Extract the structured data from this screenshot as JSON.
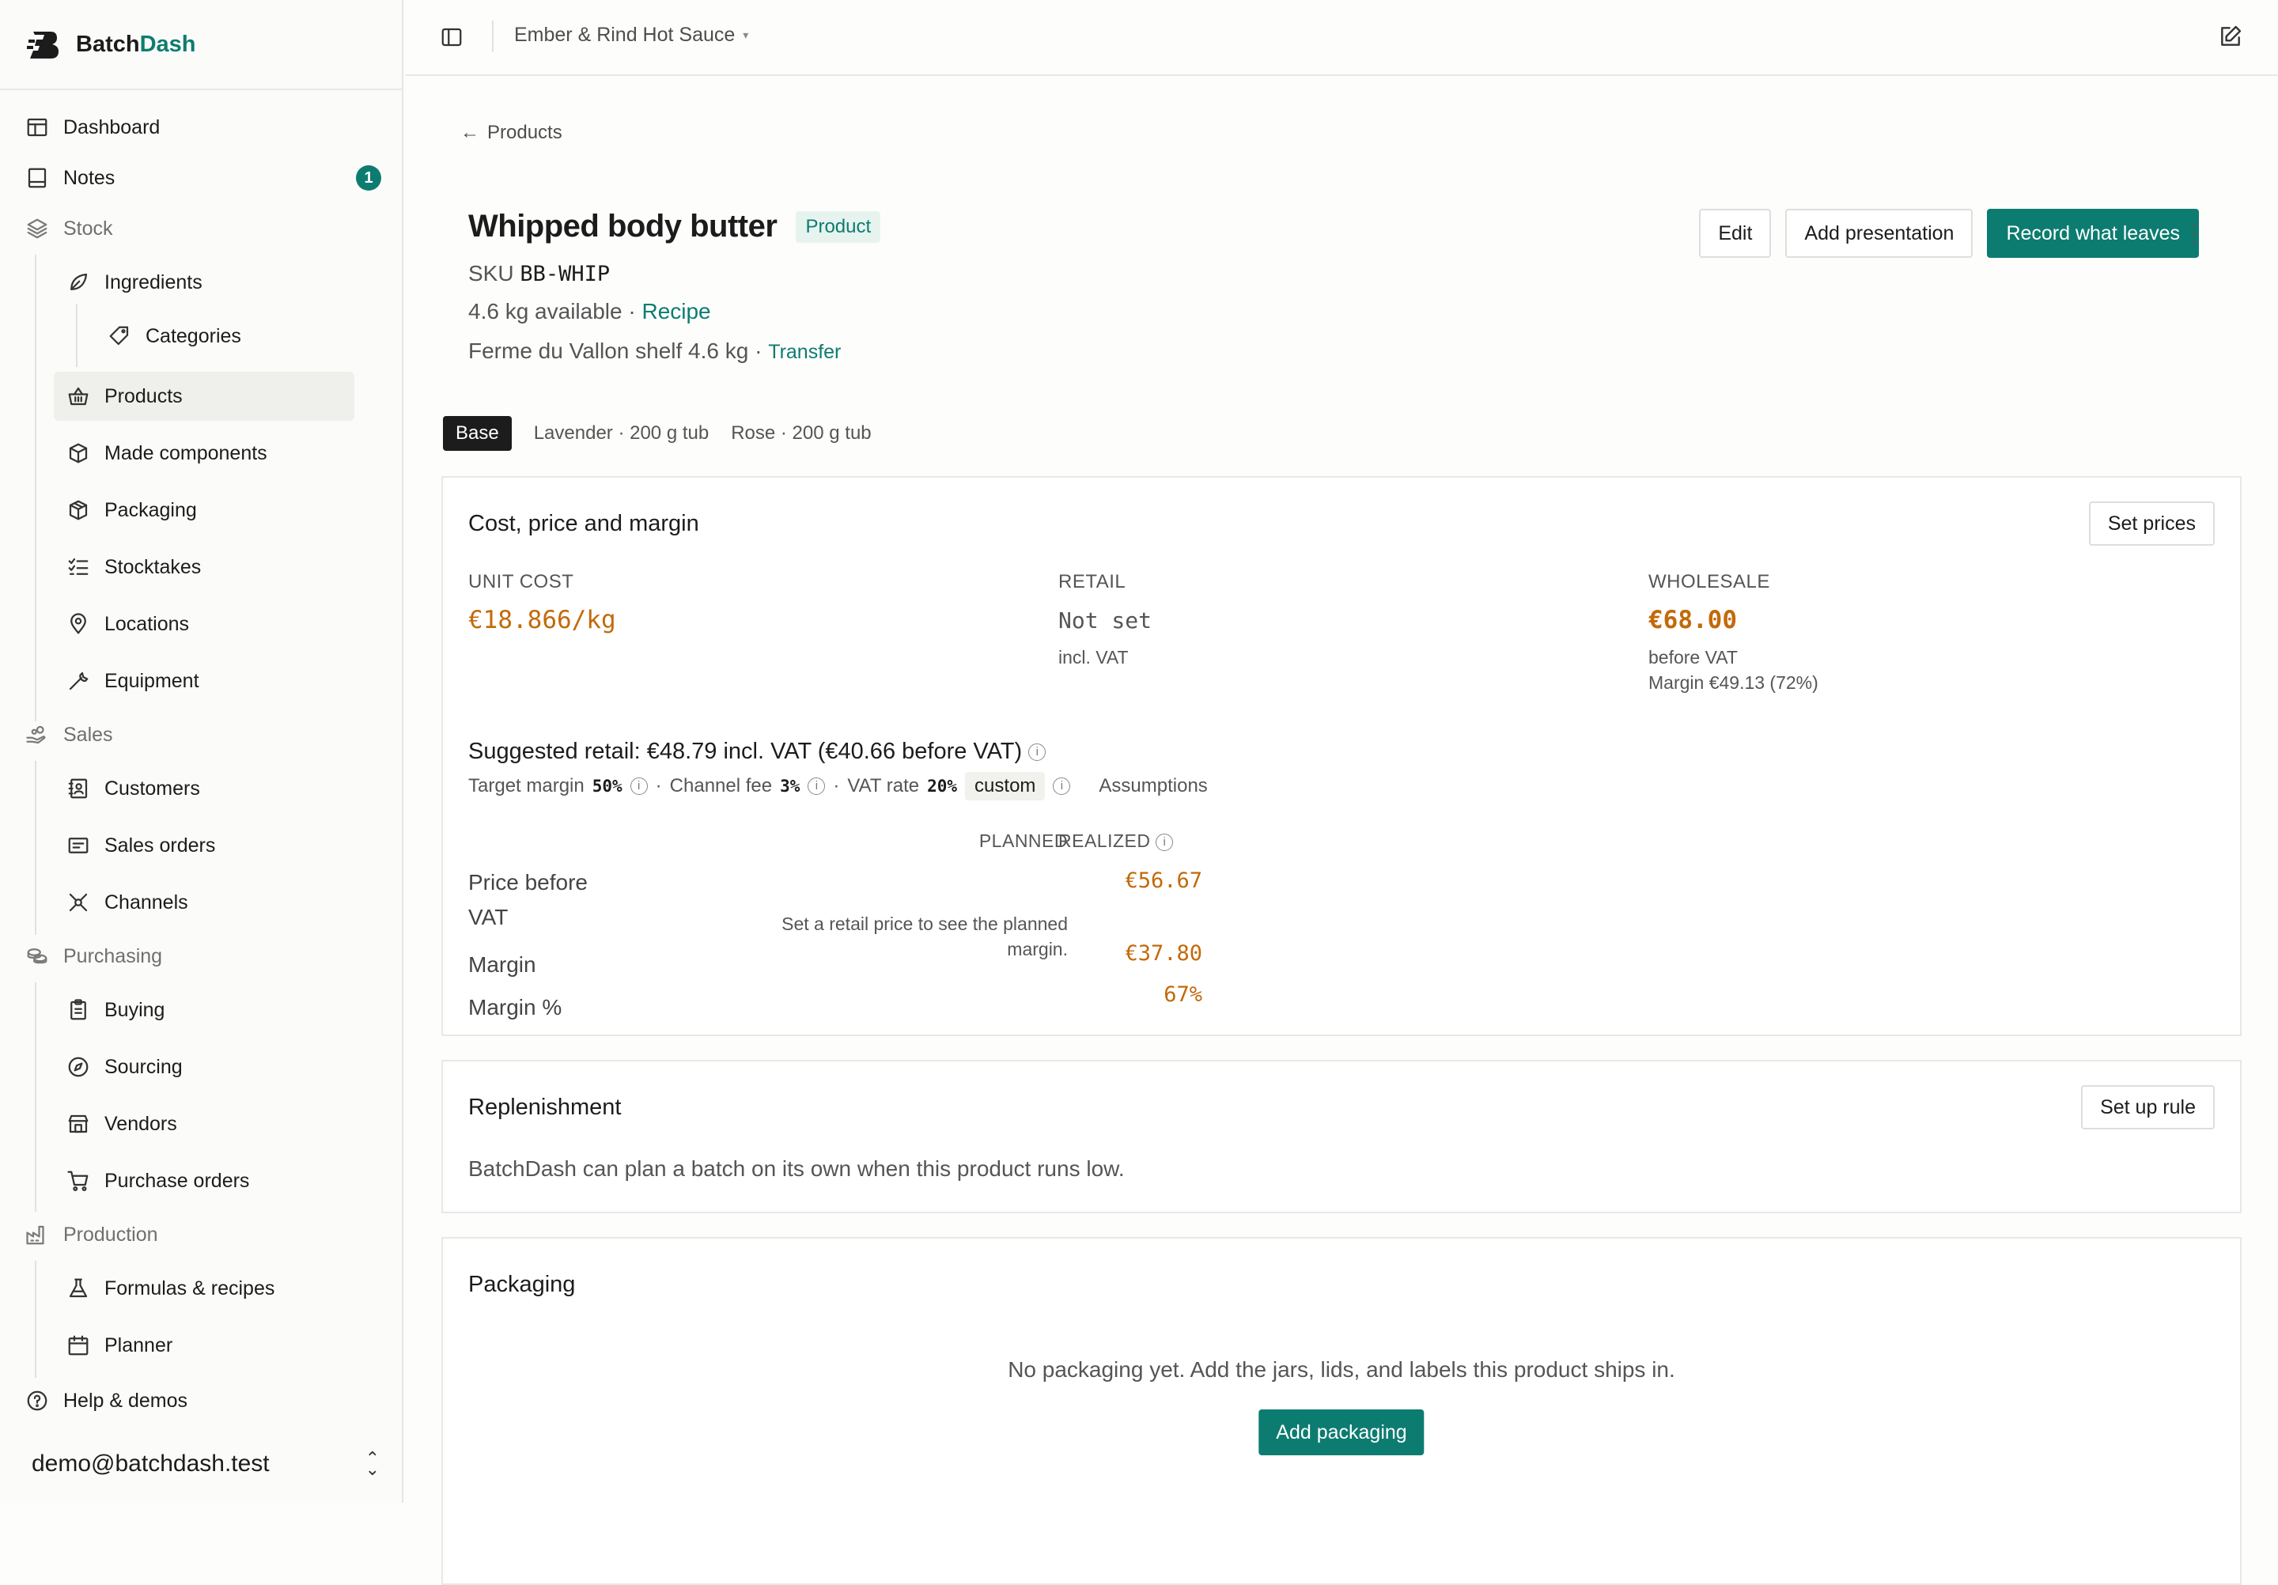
{
  "brand": {
    "name_prefix": "Batch",
    "name_accent": "Dash"
  },
  "sidebar": {
    "dashboard": "Dashboard",
    "notes": "Notes",
    "notes_badge": "1",
    "stock": "Stock",
    "ingredients": "Ingredients",
    "categories": "Categories",
    "products": "Products",
    "made_components": "Made components",
    "packaging": "Packaging",
    "stocktakes": "Stocktakes",
    "locations": "Locations",
    "equipment": "Equipment",
    "sales": "Sales",
    "customers": "Customers",
    "sales_orders": "Sales orders",
    "channels": "Channels",
    "purchasing": "Purchasing",
    "buying": "Buying",
    "sourcing": "Sourcing",
    "vendors": "Vendors",
    "purchase_orders": "Purchase orders",
    "production": "Production",
    "formulas": "Formulas & recipes",
    "planner": "Planner",
    "help": "Help & demos",
    "user_email": "demo@batchdash.test"
  },
  "topbar": {
    "workspace": "Ember & Rind Hot Sauce"
  },
  "breadcrumb": {
    "back": "Products"
  },
  "product": {
    "title": "Whipped body butter",
    "type": "Product",
    "sku_label": "SKU",
    "sku": "BB-WHIP",
    "available": "4.6 kg available",
    "recipe_sep": "·",
    "recipe": "Recipe",
    "location": "Ferme du Vallon shelf 4.6 kg",
    "transfer_sep": "·",
    "transfer": "Transfer"
  },
  "actions": {
    "edit": "Edit",
    "add_presentation": "Add presentation",
    "record": "Record what leaves"
  },
  "variants": [
    "Base",
    "Lavender · 200 g tub",
    "Rose · 200 g tub"
  ],
  "pricing": {
    "title": "Cost, price and margin",
    "set_prices": "Set prices",
    "unit_cost_label": "UNIT COST",
    "unit_cost": "€18.866/kg",
    "retail_label": "RETAIL",
    "retail": "Not set",
    "retail_sub": "incl. VAT",
    "wholesale_label": "WHOLESALE",
    "wholesale": "€68.00",
    "wholesale_sub": "before VAT",
    "wholesale_margin": "Margin €49.13 (72%)",
    "suggested": "Suggested retail: €48.79 incl. VAT (€40.66 before VAT)",
    "target_margin_label": "Target margin",
    "target_margin": "50%",
    "channel_fee_label": "Channel fee",
    "channel_fee": "3%",
    "vat_rate_label": "VAT rate",
    "vat_rate": "20%",
    "vat_custom": "custom",
    "assumptions": "Assumptions",
    "col_planned": "PLANNED",
    "col_realized": "REALIZED",
    "row_price_1": "Price before",
    "row_price_2": "VAT",
    "row_margin": "Margin",
    "row_margin_pct": "Margin %",
    "planned_note_1": "Set a retail price to see the planned",
    "planned_note_2": "margin.",
    "realized_price": "€56.67",
    "realized_margin": "€37.80",
    "realized_margin_pct": "67%"
  },
  "replenishment": {
    "title": "Replenishment",
    "button": "Set up rule",
    "text": "BatchDash can plan a batch on its own when this product runs low."
  },
  "packaging": {
    "title": "Packaging",
    "empty": "No packaging yet. Add the jars, lids, and labels this product ships in.",
    "button": "Add packaging"
  },
  "colors": {
    "accent": "#0d7c70",
    "value_orange": "#c26a0a"
  }
}
